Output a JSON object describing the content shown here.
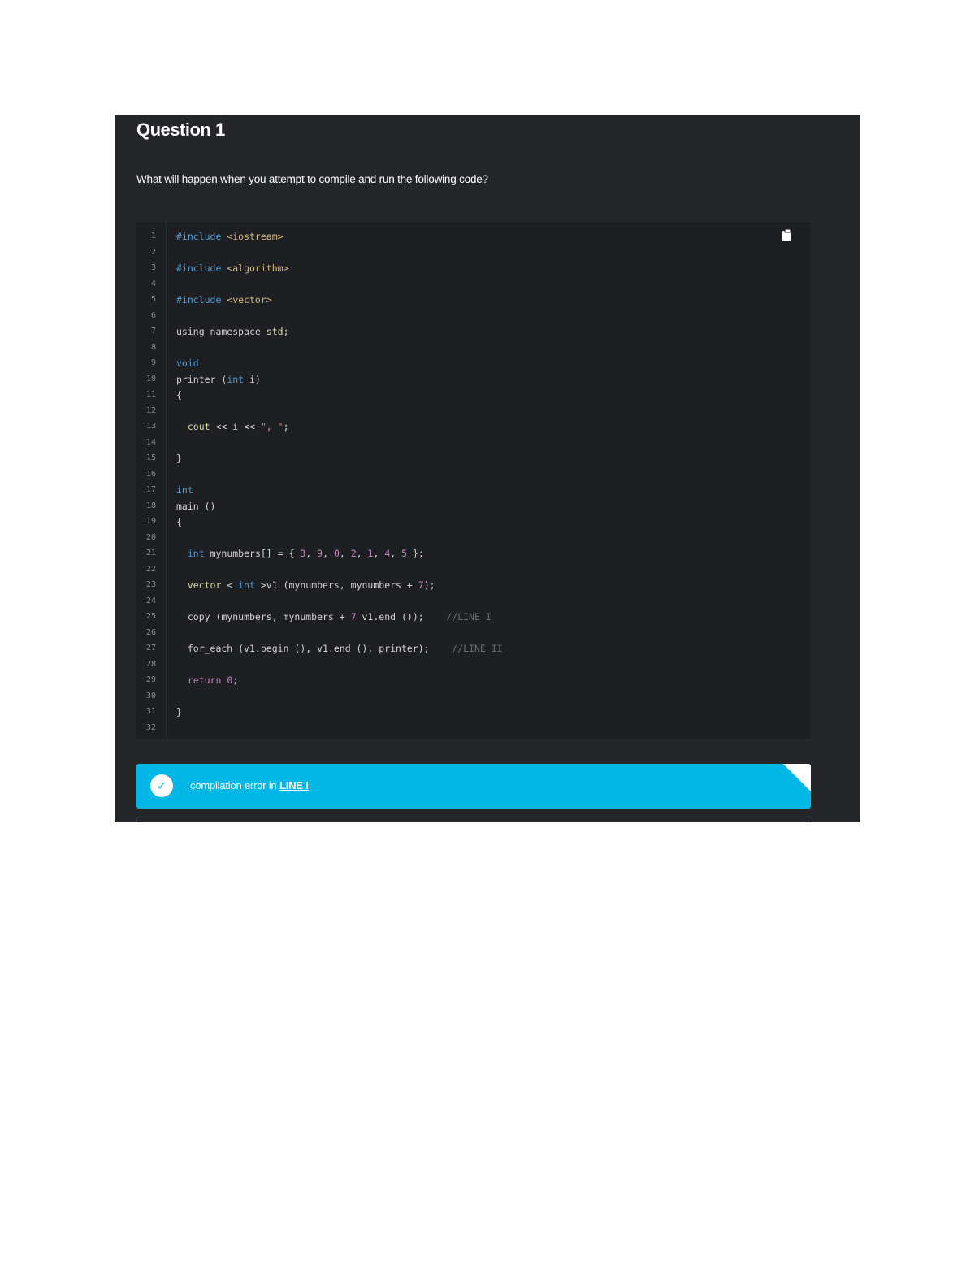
{
  "question": {
    "title": "Question 1",
    "prompt": "What will happen when you attempt to compile and run the following code?"
  },
  "code": {
    "copy_icon": "copy-icon",
    "line_numbers": [
      "1",
      "2",
      "3",
      "4",
      "5",
      "6",
      "7",
      "8",
      "9",
      "10",
      "11",
      "12",
      "13",
      "14",
      "15",
      "16",
      "17",
      "18",
      "19",
      "20",
      "21",
      "22",
      "23",
      "24",
      "25",
      "26",
      "27",
      "28",
      "29",
      "30",
      "31",
      "32"
    ],
    "lines": [
      [
        {
          "t": "#include",
          "c": "mac"
        },
        {
          "t": " <iostream>",
          "c": "inc"
        }
      ],
      [],
      [
        {
          "t": "#include",
          "c": "mac"
        },
        {
          "t": " <algorithm>",
          "c": "inc"
        }
      ],
      [],
      [
        {
          "t": "#include",
          "c": "mac"
        },
        {
          "t": " <vector>",
          "c": "inc"
        }
      ],
      [],
      [
        {
          "t": "using namespace ",
          "c": ""
        },
        {
          "t": "std",
          "c": "fn"
        },
        {
          "t": ";",
          "c": ""
        }
      ],
      [],
      [
        {
          "t": "void",
          "c": "kw"
        }
      ],
      [
        {
          "t": "printer (",
          "c": ""
        },
        {
          "t": "int",
          "c": "kw"
        },
        {
          "t": " i)",
          "c": ""
        }
      ],
      [
        {
          "t": "{",
          "c": ""
        }
      ],
      [],
      [
        {
          "t": "  cout",
          "c": "fn"
        },
        {
          "t": " << i << ",
          "c": ""
        },
        {
          "t": "\", \"",
          "c": "str"
        },
        {
          "t": ";",
          "c": ""
        }
      ],
      [],
      [
        {
          "t": "}",
          "c": ""
        }
      ],
      [],
      [
        {
          "t": "int",
          "c": "kw"
        }
      ],
      [
        {
          "t": "main ()",
          "c": ""
        }
      ],
      [
        {
          "t": "{",
          "c": ""
        }
      ],
      [],
      [
        {
          "t": "  ",
          "c": ""
        },
        {
          "t": "int",
          "c": "kw"
        },
        {
          "t": " mynumbers[] = { ",
          "c": ""
        },
        {
          "t": "3",
          "c": "num"
        },
        {
          "t": ", ",
          "c": ""
        },
        {
          "t": "9",
          "c": "num"
        },
        {
          "t": ", ",
          "c": ""
        },
        {
          "t": "0",
          "c": "num"
        },
        {
          "t": ", ",
          "c": ""
        },
        {
          "t": "2",
          "c": "num"
        },
        {
          "t": ", ",
          "c": ""
        },
        {
          "t": "1",
          "c": "num"
        },
        {
          "t": ", ",
          "c": ""
        },
        {
          "t": "4",
          "c": "num"
        },
        {
          "t": ", ",
          "c": ""
        },
        {
          "t": "5",
          "c": "num"
        },
        {
          "t": " };",
          "c": ""
        }
      ],
      [],
      [
        {
          "t": "  vector",
          "c": "fn"
        },
        {
          "t": " < ",
          "c": ""
        },
        {
          "t": "int",
          "c": "kw"
        },
        {
          "t": " >v1 (mynumbers, mynumbers + ",
          "c": ""
        },
        {
          "t": "7",
          "c": "num"
        },
        {
          "t": ");",
          "c": ""
        }
      ],
      [],
      [
        {
          "t": "  copy (mynumbers, mynumbers + ",
          "c": ""
        },
        {
          "t": "7",
          "c": "num"
        },
        {
          "t": " v1.end ());    ",
          "c": ""
        },
        {
          "t": "//LINE I",
          "c": "cm"
        }
      ],
      [],
      [
        {
          "t": "  for_each (v1.begin (), v1.end (), printer);    ",
          "c": ""
        },
        {
          "t": "//LINE II",
          "c": "cm"
        }
      ],
      [],
      [
        {
          "t": "  return",
          "c": "ret"
        },
        {
          "t": " ",
          "c": ""
        },
        {
          "t": "0",
          "c": "num"
        },
        {
          "t": ";",
          "c": ""
        }
      ],
      [],
      [
        {
          "t": "}",
          "c": ""
        }
      ],
      []
    ]
  },
  "answer": {
    "icon": "check-icon",
    "check_glyph": "✓",
    "text": "compilation error in ",
    "link": "LINE I",
    "color": "#00b7e6"
  }
}
